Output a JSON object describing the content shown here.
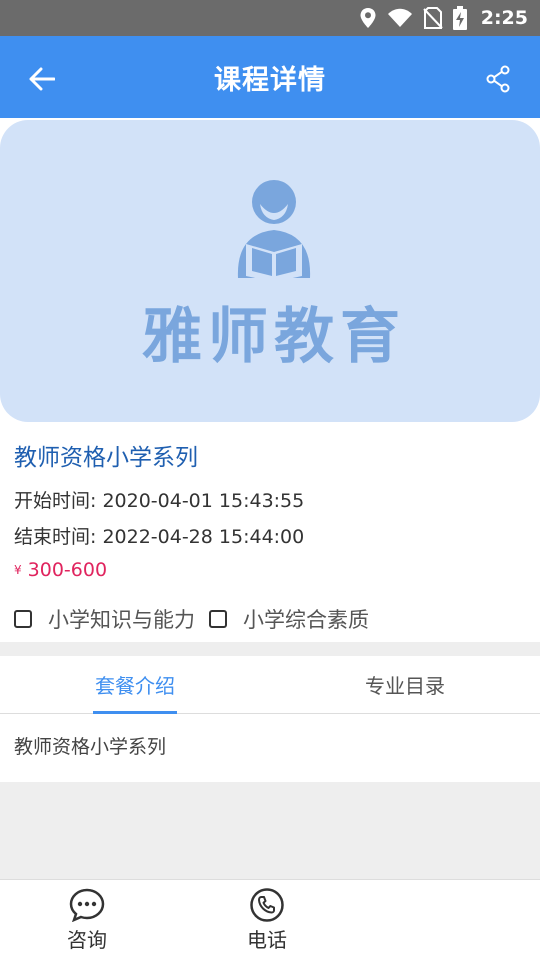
{
  "status_bar": {
    "time": "2:25",
    "icons": [
      "location-icon",
      "wifi-icon",
      "no-sim-icon",
      "battery-charging-icon"
    ]
  },
  "app_bar": {
    "title": "课程详情",
    "back_icon": "arrow-left-icon",
    "share_icon": "share-icon"
  },
  "banner": {
    "logo_text": "雅师教育",
    "background_color": "#d2e2f8"
  },
  "course": {
    "title": "教师资格小学系列",
    "start_time": "开始时间: 2020-04-01 15:43:55",
    "end_time": "结束时间: 2022-04-28 15:44:00",
    "currency_symbol": "¥",
    "price": "300-600",
    "subjects": [
      {
        "label": "小学知识与能力",
        "checked": false
      },
      {
        "label": "小学综合素质",
        "checked": false
      }
    ]
  },
  "tabs": {
    "items": [
      {
        "label": "套餐介绍",
        "active": true
      },
      {
        "label": "专业目录",
        "active": false
      }
    ],
    "content": "教师资格小学系列"
  },
  "bottom_bar": {
    "consult_label": "咨询",
    "phone_label": "电话"
  },
  "colors": {
    "primary": "#3f8ff0",
    "title_blue": "#1f5fb0",
    "price_red": "#e0245e"
  }
}
